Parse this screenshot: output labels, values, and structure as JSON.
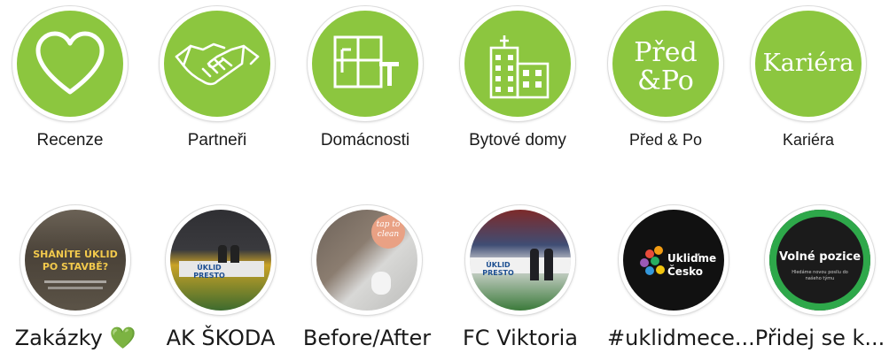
{
  "colors": {
    "accent_green": "#8cc63f",
    "ring_border": "#dcdcdc"
  },
  "highlights": [
    {
      "label": "Recenze",
      "icon": "heart-icon"
    },
    {
      "label": "Partneři",
      "icon": "handshake-icon"
    },
    {
      "label": "Domácnosti",
      "icon": "window-cleaning-icon"
    },
    {
      "label": "Bytové domy",
      "icon": "apartment-buildings-icon"
    },
    {
      "label": "Před & Po",
      "icon": "before-after-wordmark",
      "cover_line1": "Před",
      "cover_line2": "&Po"
    },
    {
      "label": "Kariéra",
      "icon": "career-wordmark",
      "cover_text": "Kariéra"
    }
  ],
  "story_highlights": [
    {
      "label": "Zakázky 💚",
      "cover_text1": "SHÁNÍTE ÚKLID",
      "cover_text2": "PO STAVBĚ?"
    },
    {
      "label": "AK ŠKODA",
      "cover_text": "ÚKLID PRESTO"
    },
    {
      "label": "Before/After",
      "cover_text1": "tap to",
      "cover_text2": "clean"
    },
    {
      "label": "FC Viktoria",
      "cover_text": "ÚKLID PRESTO"
    },
    {
      "label": "#uklidmece...",
      "cover_text1": "Ukliďme",
      "cover_text2": "Česko"
    },
    {
      "label": "Přidej se k...",
      "cover_text1": "Volné pozice",
      "cover_text2": "Hledáme novou posilu do našeho týmu"
    }
  ]
}
